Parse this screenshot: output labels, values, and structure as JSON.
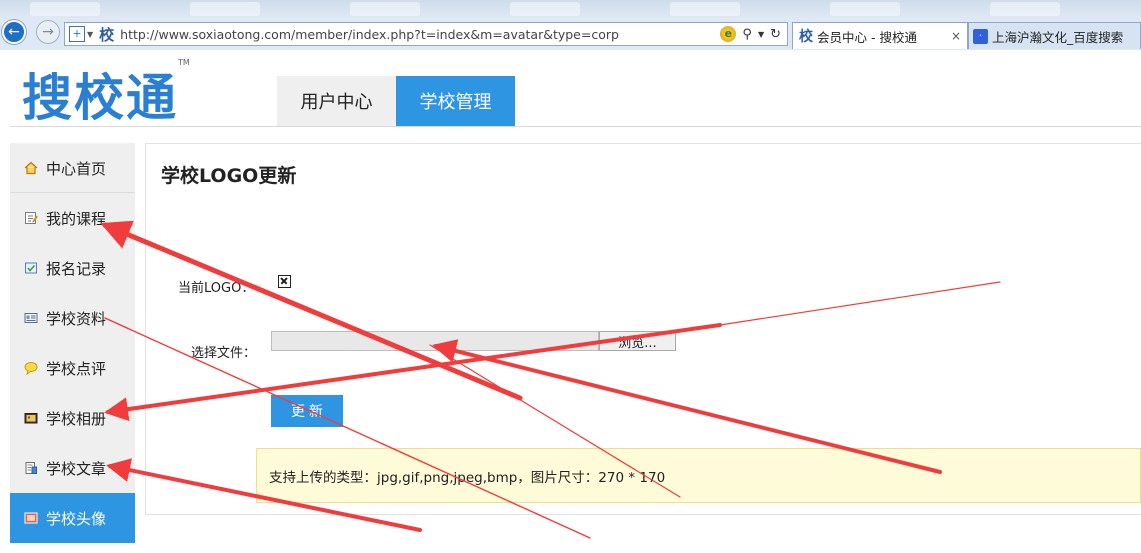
{
  "browser": {
    "back": "←",
    "forward": "→",
    "address_icon": "⬚",
    "address_favicon": "校",
    "url": "http://www.soxiaotong.com/member/index.php?t=index&m=avatar&type=corp",
    "tabs": [
      {
        "favicon": "校",
        "label": "会员中心 - 搜校通",
        "close": "×"
      },
      {
        "favicon": "·",
        "label": "上海沪瀚文化_百度搜索"
      }
    ]
  },
  "site": {
    "logo": "搜校通",
    "logo_tm": "TM",
    "nav": [
      {
        "label": "用户中心"
      },
      {
        "label": "学校管理"
      }
    ]
  },
  "sidebar": {
    "items": [
      {
        "label": "中心首页",
        "icon": "home-icon"
      },
      {
        "label": "我的课程",
        "icon": "edit-note-icon"
      },
      {
        "label": "报名记录",
        "icon": "checklist-icon"
      },
      {
        "label": "学校资料",
        "icon": "id-card-icon"
      },
      {
        "label": "学校点评",
        "icon": "speech-bubble-icon"
      },
      {
        "label": "学校相册",
        "icon": "photo-album-icon"
      },
      {
        "label": "学校文章",
        "icon": "document-icon"
      },
      {
        "label": "学校头像",
        "icon": "avatar-picture-icon"
      }
    ],
    "active_index": 7
  },
  "main": {
    "title": "学校LOGO更新",
    "current_logo_label": "当前LOGO：",
    "choose_file_label": "选择文件：",
    "browse_label": "浏览...",
    "update_label": "更 新",
    "notice": "支持上传的类型：jpg,gif,png,jpeg,bmp，图片尺寸：270 * 170"
  },
  "colors": {
    "accent": "#2e95e3",
    "annotation_arrow": "#f03c3c",
    "notice_bg": "#fefbd9"
  }
}
